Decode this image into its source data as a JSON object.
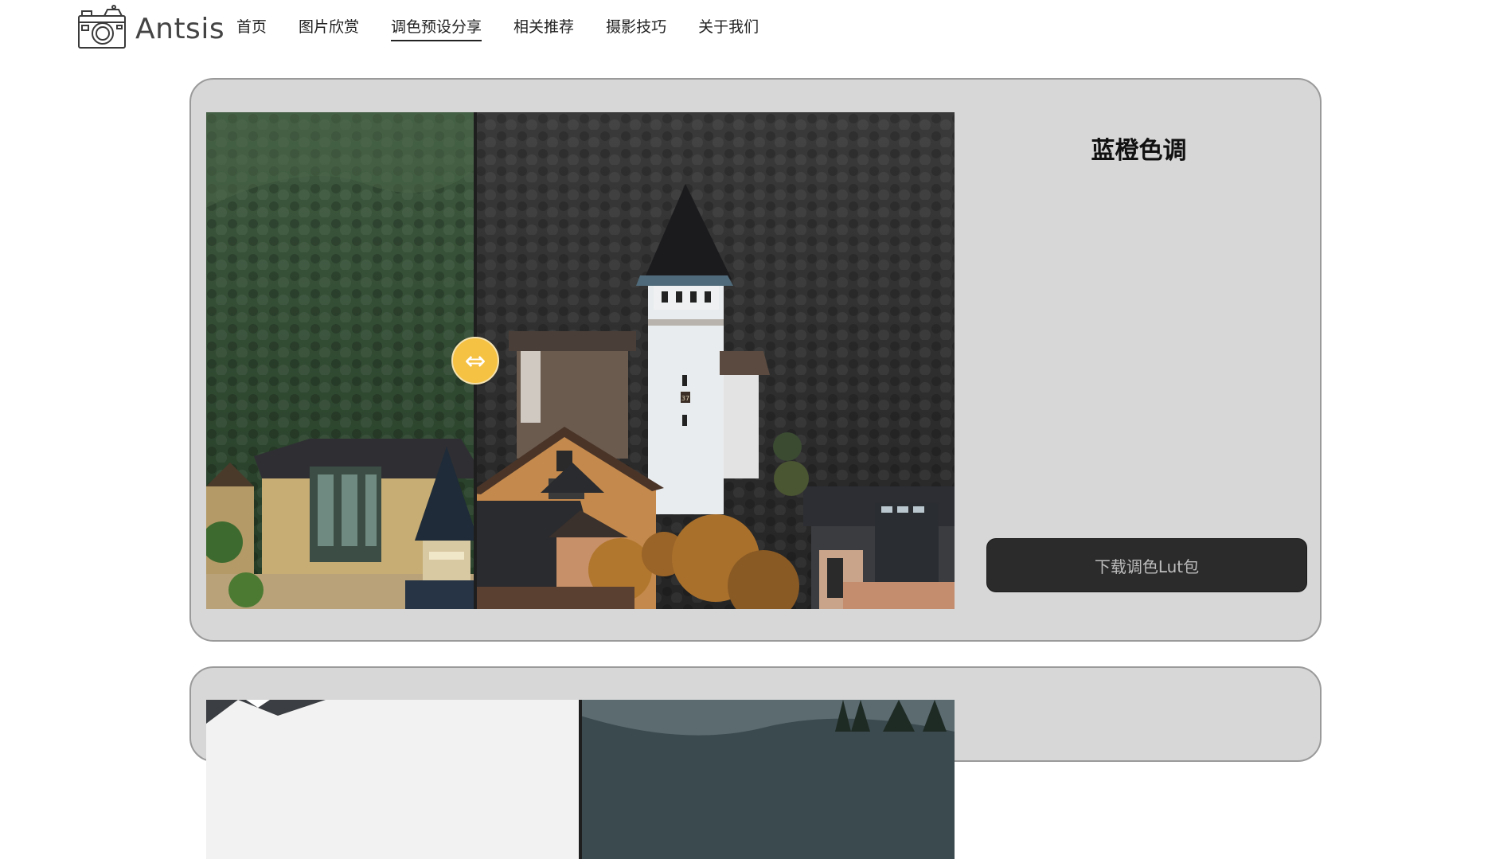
{
  "brand": {
    "name": "Antsis",
    "icon": "camera-icon"
  },
  "nav": {
    "items": [
      {
        "label": "首页",
        "active": false
      },
      {
        "label": "图片欣赏",
        "active": false
      },
      {
        "label": "调色预设分享",
        "active": true
      },
      {
        "label": "相关推荐",
        "active": false
      },
      {
        "label": "摄影技巧",
        "active": false
      },
      {
        "label": "关于我们",
        "active": false
      }
    ]
  },
  "presets": [
    {
      "title": "蓝橙色调",
      "download_label": "下载调色Lut包",
      "compare_split": 0.36,
      "handle_glyph": "⇔",
      "photo_text": "37"
    },
    {
      "title": "",
      "download_label": ""
    }
  ],
  "colors": {
    "card_bg": "#d7d7d7",
    "handle": "#f6c243",
    "button_bg": "#2b2b2b"
  }
}
